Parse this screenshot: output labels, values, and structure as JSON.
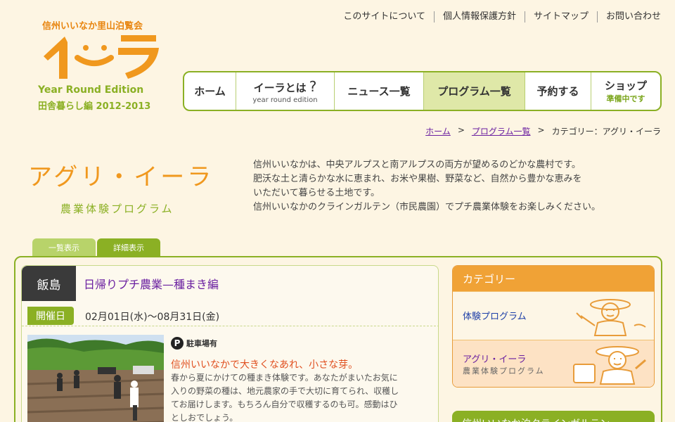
{
  "logo": {
    "top_text": "信州いいなか里山泊覧会",
    "main_text": "イーラ",
    "edition": "Year Round Edition",
    "sub": "田舎暮らし編 2012-2013"
  },
  "util_nav": [
    "このサイトについて",
    "個人情報保護方針",
    "サイトマップ",
    "お問い合わせ"
  ],
  "main_nav": {
    "home": "ホーム",
    "about": "イーラとは",
    "about_q": "?",
    "about_sub": "year round edition",
    "news": "ニュース一覧",
    "programs": "プログラム一覧",
    "reserve": "予約する",
    "shop": "ショップ",
    "shop_sub": "準備中です"
  },
  "breadcrumb": {
    "home": "ホーム",
    "programs": "プログラム一覧",
    "sep": ">",
    "current": "カテゴリー：アグリ・イーラ"
  },
  "page_title": "アグリ・イーラ",
  "page_subtitle": "農業体験プログラム",
  "intro": [
    "信州いいなかは、中央アルプスと南アルプスの両方が望めるのどかな農村です。",
    "肥沃な土と清らかな水に恵まれ、お米や果樹、野菜など、自然から豊かな恵みを",
    "いただいて暮らせる土地です。",
    "信州いいなかのクラインガルテン（市民農園）でプチ農業体験をお楽しみください。"
  ],
  "tabs": {
    "list": "一覧表示",
    "detail": "詳細表示"
  },
  "event": {
    "place": "飯島",
    "title": "日帰りプチ農業—種まき編",
    "date_label": "開催日",
    "date": "02月01日(水)〜08月31日(金)",
    "parking_icon": "P",
    "parking": "駐車場有",
    "catch": "信州いいなかで大きくなあれ、小さな芽。",
    "desc": [
      "春から夏にかけての種まき体験です。あなたがまいたお気に",
      "入りの野菜の種は、地元農家の手で大切に育てられ、収穫し",
      "てお届けします。もちろん自分で収穫するのも可。感動はひ",
      "としおでしょう。"
    ]
  },
  "sidebar": {
    "category_title": "カテゴリー",
    "items": [
      {
        "label": "体験プログラム"
      },
      {
        "label": "アグリ・イーラ",
        "sub": "農業体験プログラム"
      }
    ],
    "next_title": "信州いいなか泊クラインガルテン"
  },
  "colors": {
    "background": "#fdf5e3",
    "green": "#8bb024",
    "orange": "#f0a236",
    "purple_link": "#6a1fa0"
  }
}
